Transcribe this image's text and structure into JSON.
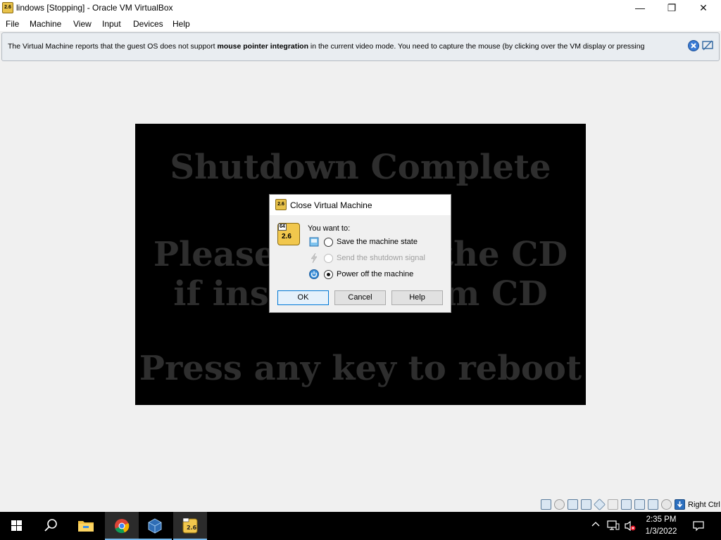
{
  "window": {
    "title": "lindows [Stopping] - Oracle VM VirtualBox",
    "controls": {
      "minimize": "—",
      "maximize": "❐",
      "close": "✕"
    }
  },
  "menubar": {
    "items": [
      "File",
      "Machine",
      "View",
      "Input",
      "Devices",
      "Help"
    ]
  },
  "notification": {
    "text_before": "The Virtual Machine reports that the guest OS does not support ",
    "text_bold": "mouse pointer integration",
    "text_after": " in the current video mode. You need to capture the mouse (by clicking over the VM display or pressing"
  },
  "vm_screen": {
    "lines": [
      "Shutdown Complete",
      "Please remove the CD",
      "if installed from CD",
      "Press any key to reboot"
    ]
  },
  "dialog": {
    "title": "Close Virtual Machine",
    "icon_badge": "64",
    "icon_version": "2.6",
    "prompt": "You want to:",
    "options": [
      {
        "label": "Save the machine state",
        "icon": "save-state-icon",
        "checked": false,
        "enabled": true
      },
      {
        "label": "Send the shutdown signal",
        "icon": "acpi-shutdown-icon",
        "checked": false,
        "enabled": false
      },
      {
        "label": "Power off the machine",
        "icon": "power-off-icon",
        "checked": true,
        "enabled": true
      }
    ],
    "buttons": {
      "ok": "OK",
      "cancel": "Cancel",
      "help": "Help"
    }
  },
  "statusbar": {
    "host_key": "Right Ctrl",
    "icons": [
      "hard-disk-icon",
      "optical-drive-icon",
      "audio-icon",
      "network-icon",
      "usb-icon",
      "shared-folders-icon",
      "display-icon",
      "recording-icon",
      "cpu-icon",
      "mouse-integration-icon",
      "keyboard-capture-icon"
    ]
  },
  "taskbar": {
    "apps": [
      "start-icon",
      "search-icon",
      "file-explorer-icon",
      "chrome-icon",
      "virtualbox-icon",
      "vm-window-icon"
    ],
    "clock_time": "2:35 PM",
    "clock_date": "1/3/2022"
  },
  "colors": {
    "accent": "#0078d7",
    "vm_text": "#2e2e2e",
    "notice_bg": "#e9edf1"
  }
}
